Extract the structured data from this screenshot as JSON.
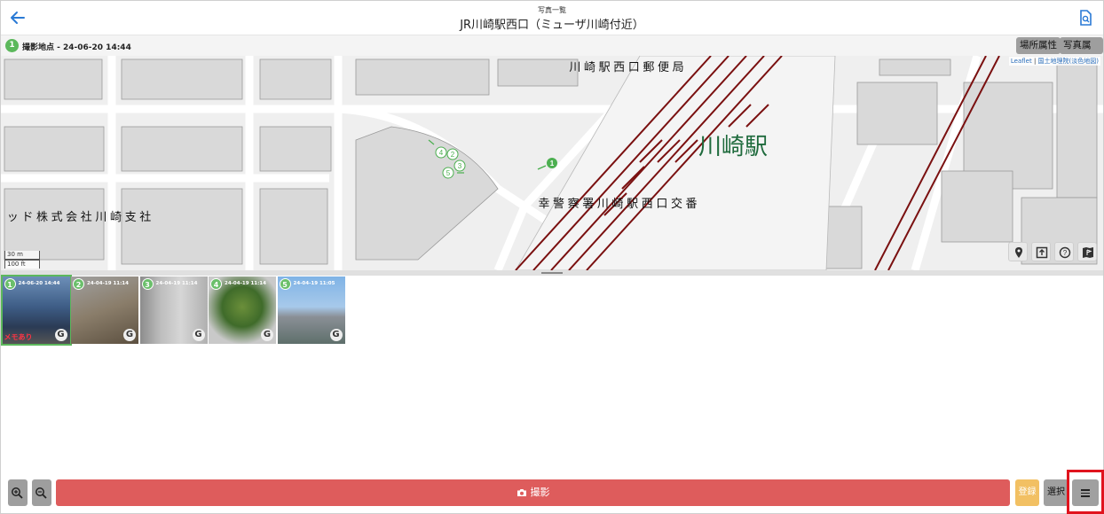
{
  "header": {
    "subtitle": "写真一覧",
    "title": "JR川崎駅西口（ミューザ川崎付近）"
  },
  "infobar": {
    "badge": "1",
    "location_text": "撮影地点 - 24-06-20 14:44",
    "place_attr_button": "場所属性",
    "photo_attr_button": "写真属性"
  },
  "map": {
    "attribution_leaflet": "Leaflet",
    "attribution_sep": " | ",
    "attribution_source": "国土地理院(淡色地図)",
    "label_post_office": "川 崎 駅 西 口 郵 便 局",
    "label_station": "川崎駅",
    "label_police": "幸 警 察 署 川 崎 駅 西 口 交 番",
    "label_company": "ッ ド 株 式 会 社 川 崎 支 社",
    "scale_metric": "30 m",
    "scale_imperial": "100 ft",
    "markers": [
      "1",
      "2",
      "3",
      "4",
      "5"
    ]
  },
  "thumbnails": [
    {
      "num": "1",
      "date": "24-06-20 14:44",
      "memo": "メモあり",
      "selected": true
    },
    {
      "num": "2",
      "date": "24-04-19 11:14",
      "memo": "",
      "selected": false
    },
    {
      "num": "3",
      "date": "24-04-19 11:14",
      "memo": "",
      "selected": false
    },
    {
      "num": "4",
      "date": "24-04-19 11:14",
      "memo": "",
      "selected": false
    },
    {
      "num": "5",
      "date": "24-04-19 11:05",
      "memo": "",
      "selected": false
    }
  ],
  "toolbar": {
    "capture_label": "撮影",
    "register_label": "登録",
    "select_label": "選択"
  },
  "colors": {
    "accent_green": "#5cb85c",
    "capture_red": "#de5c5c",
    "register_yellow": "#f2c063",
    "highlight_red": "#e0141e",
    "rail_red": "#7a1010"
  }
}
